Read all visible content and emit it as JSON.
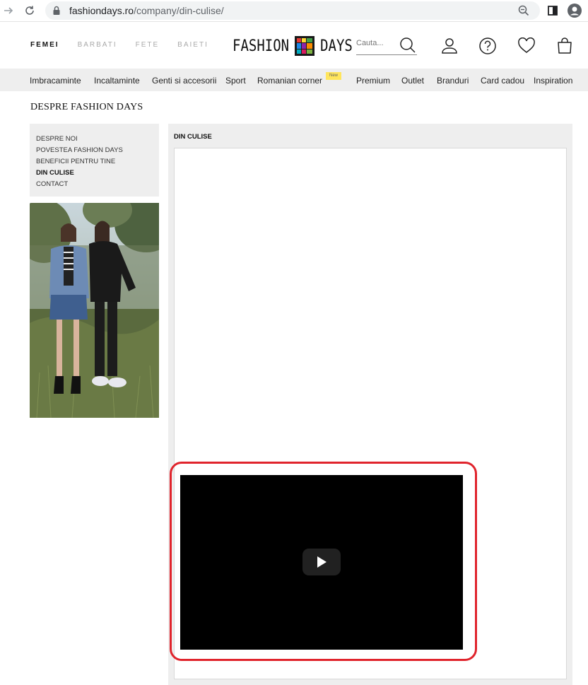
{
  "browser": {
    "url_host": "fashiondays.ro",
    "url_path": "/company/din-culise/"
  },
  "header": {
    "gender_nav": [
      "FEMEI",
      "BARBATI",
      "FETE",
      "BAIETI"
    ],
    "logo_left": "FASHION",
    "logo_right": "DAYS",
    "search_placeholder": "Cauta..."
  },
  "categories": {
    "items": [
      "Imbracaminte",
      "Incaltaminte",
      "Genti si accesorii",
      "Sport",
      "Romanian corner",
      "Premium",
      "Outlet",
      "Branduri",
      "Card cadou",
      "Inspiration"
    ],
    "new_badge": "New"
  },
  "page": {
    "title": "DESPRE FASHION DAYS",
    "side_menu": [
      "DESPRE NOI",
      "POVESTEA FASHION DAYS",
      "BENEFICII PENTRU TINE",
      "DIN CULISE",
      "CONTACT"
    ],
    "active_menu": "DIN CULISE",
    "content_title": "DIN CULISE"
  },
  "colors": {
    "highlight": "#e0242c",
    "nav_bar": "#eeeeee",
    "new_badge": "#ffe55c"
  }
}
